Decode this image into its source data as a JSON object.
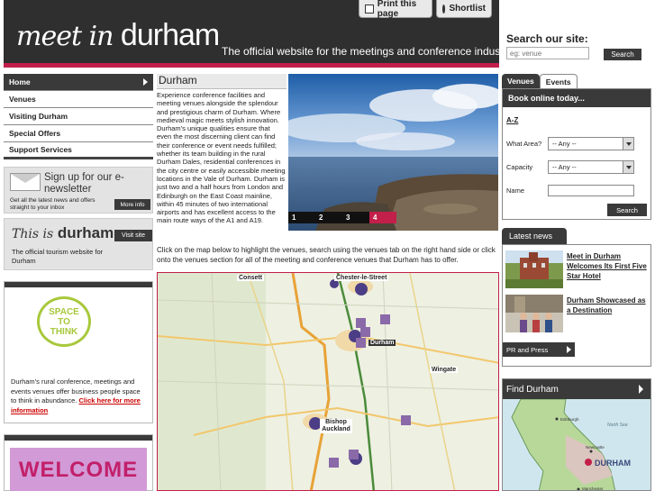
{
  "header": {
    "logo_script": "meet in",
    "logo_word": "durham",
    "tagline": "The official website for the meetings and conference industry",
    "print_label": "Print this page",
    "shortlist_label": "Shortlist"
  },
  "search": {
    "title": "Search our site:",
    "placeholder": "eg: venue",
    "button": "Search"
  },
  "nav": {
    "items": [
      "Home",
      "Venues",
      "Visiting Durham",
      "Special Offers",
      "Support Services"
    ]
  },
  "newsletter": {
    "headline": "Sign up for our e-newsletter",
    "text": "Get all the latest news and offers straight to your inbox",
    "button": "More info"
  },
  "thisis": {
    "brand_prefix": "This is",
    "brand_word": "durham",
    "button": "Visit site",
    "text": "The official tourism website for Durham"
  },
  "space": {
    "logo_line1": "SPACE",
    "logo_line2": "TO",
    "logo_line3": "THINK",
    "text": "Durham's rural conference, meetings and events venues offer business people space to think in abundance.",
    "link": "Click here for more information"
  },
  "welcome": {
    "text": "WELCOME"
  },
  "main": {
    "title": "Durham",
    "body": "Experience conference facilities and meeting venues alongside the splendour and prestigious charm of Durham. Where medieval magic meets stylish innovation. Durham's unique qualities ensure that even the most discerning client can find their conference or event needs fulfilled; whether its team building in the rural Durham Dales, residential conferences in the city centre or easily accessible meeting locations in the Vale of Durham. Durham is just two and a half hours from London and Edinburgh on the East Coast mainline, within 45 minutes of two international airports and has excellent access to the main route ways of the A1 and A19.",
    "slides": [
      "1",
      "2",
      "3",
      "4"
    ],
    "map_intro": "Click on the map below to highlight the venues, search using the venues tab on the right hand side or click onto the venues section for all of the meeting and conference venues that Durham has to offer.",
    "map_labels": [
      "Consett",
      "Chester-le-Street",
      "Durham",
      "Wingate",
      "Bishop Auckland"
    ]
  },
  "booking": {
    "tabs": [
      "Venues",
      "Events"
    ],
    "head": "Book online today...",
    "az": "A-Z",
    "area_label": "What Area?",
    "area_value": "-- Any --",
    "capacity_label": "Capacity",
    "capacity_value": "-- Any --",
    "name_label": "Name",
    "button": "Search"
  },
  "news": {
    "tab": "Latest news",
    "items": [
      "Meet in Durham Welcomes Its First Five Star Hotel",
      "Durham Showcased as a Destination"
    ],
    "pr_button": "PR and Press"
  },
  "find": {
    "title": "Find Durham",
    "map_label": "DURHAM",
    "map_small": [
      "Edinburgh",
      "Newcastle",
      "Manchester",
      "North Sea"
    ]
  }
}
